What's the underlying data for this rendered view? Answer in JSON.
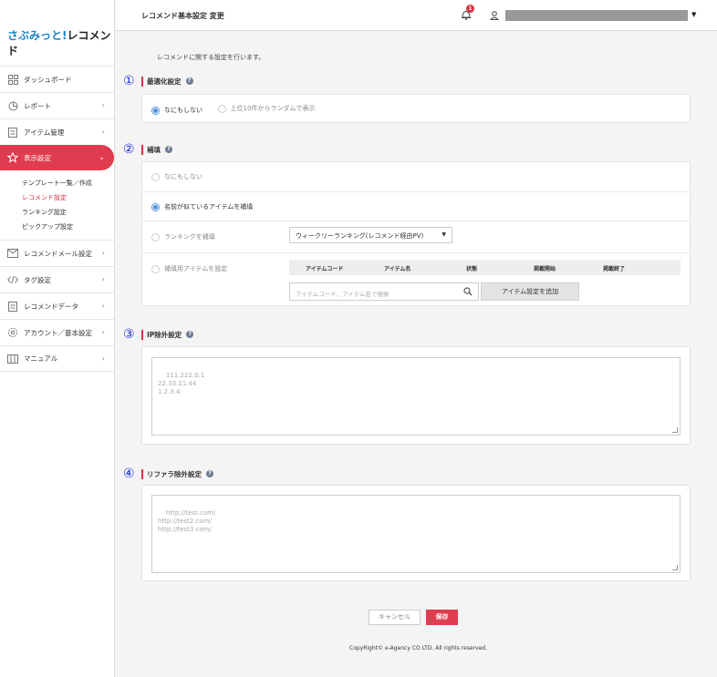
{
  "app": {
    "logo_part1": "さぶみっと!",
    "logo_part2": "レコメンド"
  },
  "sidebar": {
    "items": [
      {
        "label": "ダッシュボード",
        "icon": "dashboard-icon"
      },
      {
        "label": "レポート",
        "icon": "report-icon"
      },
      {
        "label": "アイテム管理",
        "icon": "clipboard-icon"
      },
      {
        "label": "表示設定",
        "icon": "star-icon",
        "active": true
      },
      {
        "label": "レコメンドメール設定",
        "icon": "mail-icon"
      },
      {
        "label": "タグ設定",
        "icon": "code-icon"
      },
      {
        "label": "レコメンドデータ",
        "icon": "clipboard-icon"
      },
      {
        "label": "アカウント／基本設定",
        "icon": "gear-icon"
      },
      {
        "label": "マニュアル",
        "icon": "book-icon"
      }
    ],
    "subitems": [
      "テンプレート一覧／作成",
      "レコメンド設定",
      "ランキング設定",
      "ピックアップ設定"
    ]
  },
  "header": {
    "title": "レコメンド基本設定 変更",
    "notification_count": "1"
  },
  "main": {
    "intro": "レコメンドに関する設定を行います。",
    "sections": [
      {
        "num": "①",
        "title": "最適化設定"
      },
      {
        "num": "②",
        "title": "補填"
      },
      {
        "num": "③",
        "title": "IP除外設定"
      },
      {
        "num": "④",
        "title": "リファラ除外設定"
      }
    ],
    "optimize": {
      "opt1": "なにもしない",
      "opt2": "上位10件からランダムで表示"
    },
    "supplement": {
      "opt1": "なにもしない",
      "opt2": "名前が似ているアイテムを補填",
      "opt3": "ランキングを補填",
      "opt4": "補填用アイテムを設定",
      "ranking_select": "ウィークリーランキング(レコメンド経由PV)",
      "columns": [
        "アイテムコード",
        "アイテム名",
        "状態",
        "掲載開始",
        "掲載終了"
      ],
      "search_placeholder": "アイテムコード、アイテム名で検索",
      "add_button": "アイテム設定を追加"
    },
    "ip_placeholder": "111.222.0.1\n22.33.11.44\n1.2.3.4",
    "referrer_placeholder": "http://test.com/\nhttp://test2.com/\nhttp://test3.com/",
    "cancel_label": "キャンセル",
    "save_label": "保存"
  },
  "footer": {
    "copyright": "CopyRight© e-Agency CO LTD. All rights reserved."
  },
  "colors": {
    "accent": "#e03c4f",
    "section_num": "#1a2fd6",
    "radio": "#4a90d9"
  }
}
